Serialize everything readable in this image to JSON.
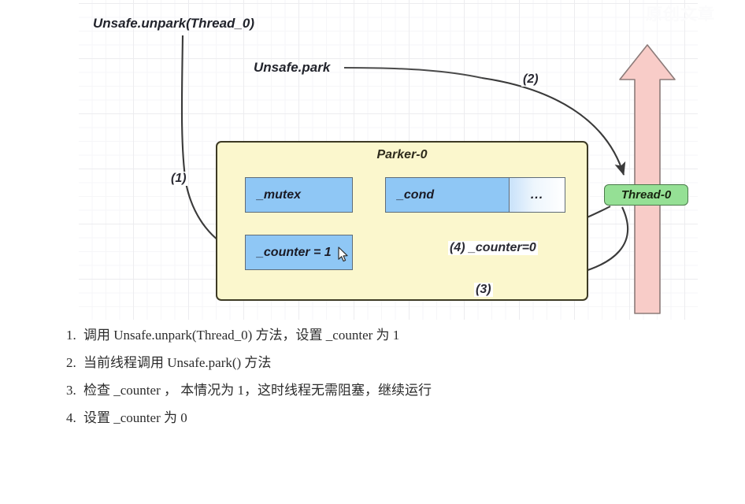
{
  "diagram": {
    "watermark": "原创文章",
    "captions": {
      "unpark_call": "Unsafe.unpark(Thread_0)",
      "park_call": "Unsafe.park"
    },
    "steps": {
      "one": "(1)",
      "two": "(2)",
      "three": "(3)",
      "four": "(4) _counter=0"
    },
    "parker": {
      "title": "Parker-0",
      "fields": [
        {
          "name": "mutex-field",
          "label": "_mutex"
        },
        {
          "name": "cond-field",
          "label": "_cond"
        },
        {
          "name": "more-field",
          "label": "..."
        },
        {
          "name": "counter-field",
          "label": "_counter = 1"
        }
      ]
    },
    "thread": {
      "label": "Thread-0"
    },
    "colors": {
      "parker_fill": "#fbf7cd",
      "parker_border": "#3d3a24",
      "field_fill": "#8fc7f5",
      "field_border": "#5f6c78",
      "thread_fill": "#95e095",
      "thread_border": "#4a7a4a",
      "big_arrow_fill": "#f8ccc8",
      "big_arrow_border": "#8c7b79",
      "connector": "#3a3a3a",
      "grid_line": "#ececef"
    }
  },
  "notes": [
    {
      "num": "1.",
      "text": "调用 Unsafe.unpark(Thread_0) 方法，设置 _counter 为 1"
    },
    {
      "num": "2.",
      "text": "当前线程调用 Unsafe.park() 方法"
    },
    {
      "num": "3.",
      "text": "检查 _counter ， 本情况为 1，这时线程无需阻塞，继续运行"
    },
    {
      "num": "4.",
      "text": "设置 _counter 为 0"
    }
  ]
}
